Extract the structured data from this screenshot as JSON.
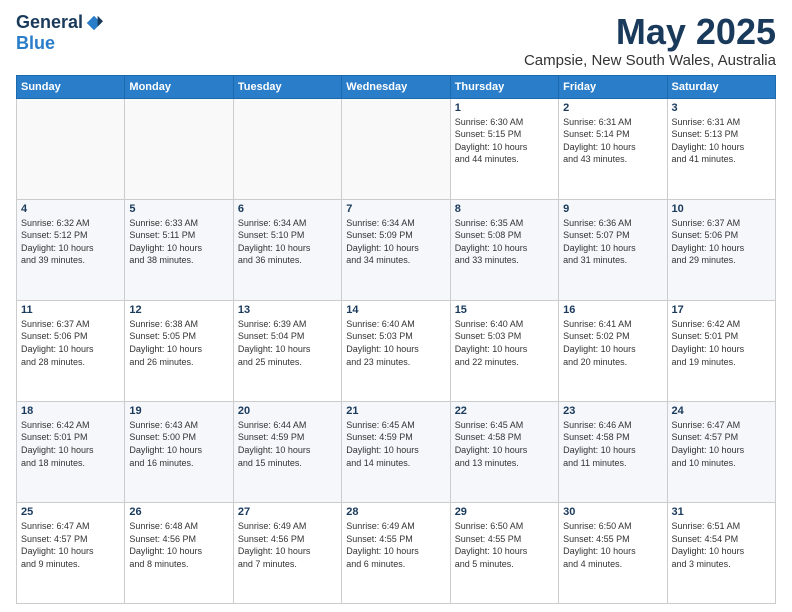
{
  "logo": {
    "general": "General",
    "blue": "Blue"
  },
  "title": "May 2025",
  "location": "Campsie, New South Wales, Australia",
  "weekdays": [
    "Sunday",
    "Monday",
    "Tuesday",
    "Wednesday",
    "Thursday",
    "Friday",
    "Saturday"
  ],
  "weeks": [
    [
      {
        "day": "",
        "info": ""
      },
      {
        "day": "",
        "info": ""
      },
      {
        "day": "",
        "info": ""
      },
      {
        "day": "",
        "info": ""
      },
      {
        "day": "1",
        "info": "Sunrise: 6:30 AM\nSunset: 5:15 PM\nDaylight: 10 hours\nand 44 minutes."
      },
      {
        "day": "2",
        "info": "Sunrise: 6:31 AM\nSunset: 5:14 PM\nDaylight: 10 hours\nand 43 minutes."
      },
      {
        "day": "3",
        "info": "Sunrise: 6:31 AM\nSunset: 5:13 PM\nDaylight: 10 hours\nand 41 minutes."
      }
    ],
    [
      {
        "day": "4",
        "info": "Sunrise: 6:32 AM\nSunset: 5:12 PM\nDaylight: 10 hours\nand 39 minutes."
      },
      {
        "day": "5",
        "info": "Sunrise: 6:33 AM\nSunset: 5:11 PM\nDaylight: 10 hours\nand 38 minutes."
      },
      {
        "day": "6",
        "info": "Sunrise: 6:34 AM\nSunset: 5:10 PM\nDaylight: 10 hours\nand 36 minutes."
      },
      {
        "day": "7",
        "info": "Sunrise: 6:34 AM\nSunset: 5:09 PM\nDaylight: 10 hours\nand 34 minutes."
      },
      {
        "day": "8",
        "info": "Sunrise: 6:35 AM\nSunset: 5:08 PM\nDaylight: 10 hours\nand 33 minutes."
      },
      {
        "day": "9",
        "info": "Sunrise: 6:36 AM\nSunset: 5:07 PM\nDaylight: 10 hours\nand 31 minutes."
      },
      {
        "day": "10",
        "info": "Sunrise: 6:37 AM\nSunset: 5:06 PM\nDaylight: 10 hours\nand 29 minutes."
      }
    ],
    [
      {
        "day": "11",
        "info": "Sunrise: 6:37 AM\nSunset: 5:06 PM\nDaylight: 10 hours\nand 28 minutes."
      },
      {
        "day": "12",
        "info": "Sunrise: 6:38 AM\nSunset: 5:05 PM\nDaylight: 10 hours\nand 26 minutes."
      },
      {
        "day": "13",
        "info": "Sunrise: 6:39 AM\nSunset: 5:04 PM\nDaylight: 10 hours\nand 25 minutes."
      },
      {
        "day": "14",
        "info": "Sunrise: 6:40 AM\nSunset: 5:03 PM\nDaylight: 10 hours\nand 23 minutes."
      },
      {
        "day": "15",
        "info": "Sunrise: 6:40 AM\nSunset: 5:03 PM\nDaylight: 10 hours\nand 22 minutes."
      },
      {
        "day": "16",
        "info": "Sunrise: 6:41 AM\nSunset: 5:02 PM\nDaylight: 10 hours\nand 20 minutes."
      },
      {
        "day": "17",
        "info": "Sunrise: 6:42 AM\nSunset: 5:01 PM\nDaylight: 10 hours\nand 19 minutes."
      }
    ],
    [
      {
        "day": "18",
        "info": "Sunrise: 6:42 AM\nSunset: 5:01 PM\nDaylight: 10 hours\nand 18 minutes."
      },
      {
        "day": "19",
        "info": "Sunrise: 6:43 AM\nSunset: 5:00 PM\nDaylight: 10 hours\nand 16 minutes."
      },
      {
        "day": "20",
        "info": "Sunrise: 6:44 AM\nSunset: 4:59 PM\nDaylight: 10 hours\nand 15 minutes."
      },
      {
        "day": "21",
        "info": "Sunrise: 6:45 AM\nSunset: 4:59 PM\nDaylight: 10 hours\nand 14 minutes."
      },
      {
        "day": "22",
        "info": "Sunrise: 6:45 AM\nSunset: 4:58 PM\nDaylight: 10 hours\nand 13 minutes."
      },
      {
        "day": "23",
        "info": "Sunrise: 6:46 AM\nSunset: 4:58 PM\nDaylight: 10 hours\nand 11 minutes."
      },
      {
        "day": "24",
        "info": "Sunrise: 6:47 AM\nSunset: 4:57 PM\nDaylight: 10 hours\nand 10 minutes."
      }
    ],
    [
      {
        "day": "25",
        "info": "Sunrise: 6:47 AM\nSunset: 4:57 PM\nDaylight: 10 hours\nand 9 minutes."
      },
      {
        "day": "26",
        "info": "Sunrise: 6:48 AM\nSunset: 4:56 PM\nDaylight: 10 hours\nand 8 minutes."
      },
      {
        "day": "27",
        "info": "Sunrise: 6:49 AM\nSunset: 4:56 PM\nDaylight: 10 hours\nand 7 minutes."
      },
      {
        "day": "28",
        "info": "Sunrise: 6:49 AM\nSunset: 4:55 PM\nDaylight: 10 hours\nand 6 minutes."
      },
      {
        "day": "29",
        "info": "Sunrise: 6:50 AM\nSunset: 4:55 PM\nDaylight: 10 hours\nand 5 minutes."
      },
      {
        "day": "30",
        "info": "Sunrise: 6:50 AM\nSunset: 4:55 PM\nDaylight: 10 hours\nand 4 minutes."
      },
      {
        "day": "31",
        "info": "Sunrise: 6:51 AM\nSunset: 4:54 PM\nDaylight: 10 hours\nand 3 minutes."
      }
    ]
  ]
}
